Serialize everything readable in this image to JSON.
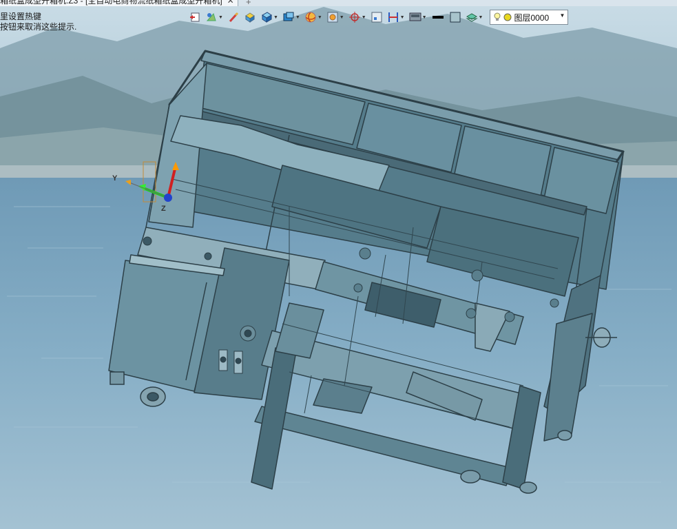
{
  "window": {
    "tab_title": "箱纸盒成型开箱机.Z3 - [全自动电商物流纸箱纸盒成型开箱机]",
    "tab_close": "✕",
    "tab_add": "+"
  },
  "hint": {
    "line1": "里设置热键",
    "line2": "按钮来取消这些提示."
  },
  "toolbar": {
    "items": [
      {
        "icon": "view-exit-icon",
        "dropdown": false
      },
      {
        "icon": "sketch-icon",
        "dropdown": true
      },
      {
        "icon": "pencil-icon",
        "dropdown": false
      },
      {
        "icon": "box-shaded-icon",
        "dropdown": false
      },
      {
        "icon": "cube-icon",
        "dropdown": true
      },
      {
        "icon": "solid-view-icon",
        "dropdown": true
      },
      {
        "icon": "orbit-icon",
        "dropdown": true
      },
      {
        "icon": "zoom-fit-icon",
        "dropdown": true
      },
      {
        "icon": "target-icon",
        "dropdown": true
      },
      {
        "icon": "frame-icon",
        "dropdown": false
      },
      {
        "icon": "dimension-icon",
        "dropdown": true
      },
      {
        "icon": "monitor-icon",
        "dropdown": true
      },
      {
        "icon": "line-color-icon",
        "dropdown": false
      },
      {
        "icon": "fill-color-icon",
        "dropdown": false
      },
      {
        "icon": "layers-icon",
        "dropdown": true
      }
    ],
    "layer": {
      "label": "图层0000"
    }
  },
  "triad": {
    "x_label": "Y",
    "y_label": "Z"
  },
  "colors": {
    "machine_body": "#5f8796",
    "machine_dark": "#3e5e6b",
    "machine_light": "#86a9b6",
    "frame_edge": "#2c3f47",
    "sky": "#b9d0de",
    "water": "#7ea8c2"
  }
}
